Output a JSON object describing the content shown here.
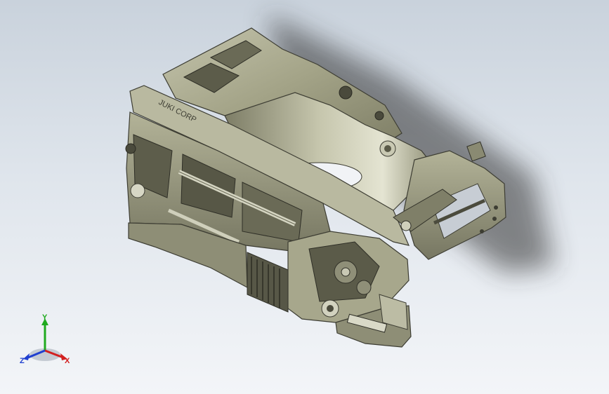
{
  "viewport": {
    "background_top": "#c9d2dc",
    "background_bottom": "#f3f5f8"
  },
  "model": {
    "part_color": "#a9a98d",
    "shade_color": "#6f6f5a",
    "dark_color": "#3d3d33",
    "highlight_color": "#d8d8c4",
    "engraved_text": "JUKI CORP"
  },
  "triad": {
    "x_label": "X",
    "y_label": "Y",
    "z_label": "Z",
    "x_color": "#d22020",
    "y_color": "#1faa1f",
    "z_color": "#1f3fd0"
  }
}
